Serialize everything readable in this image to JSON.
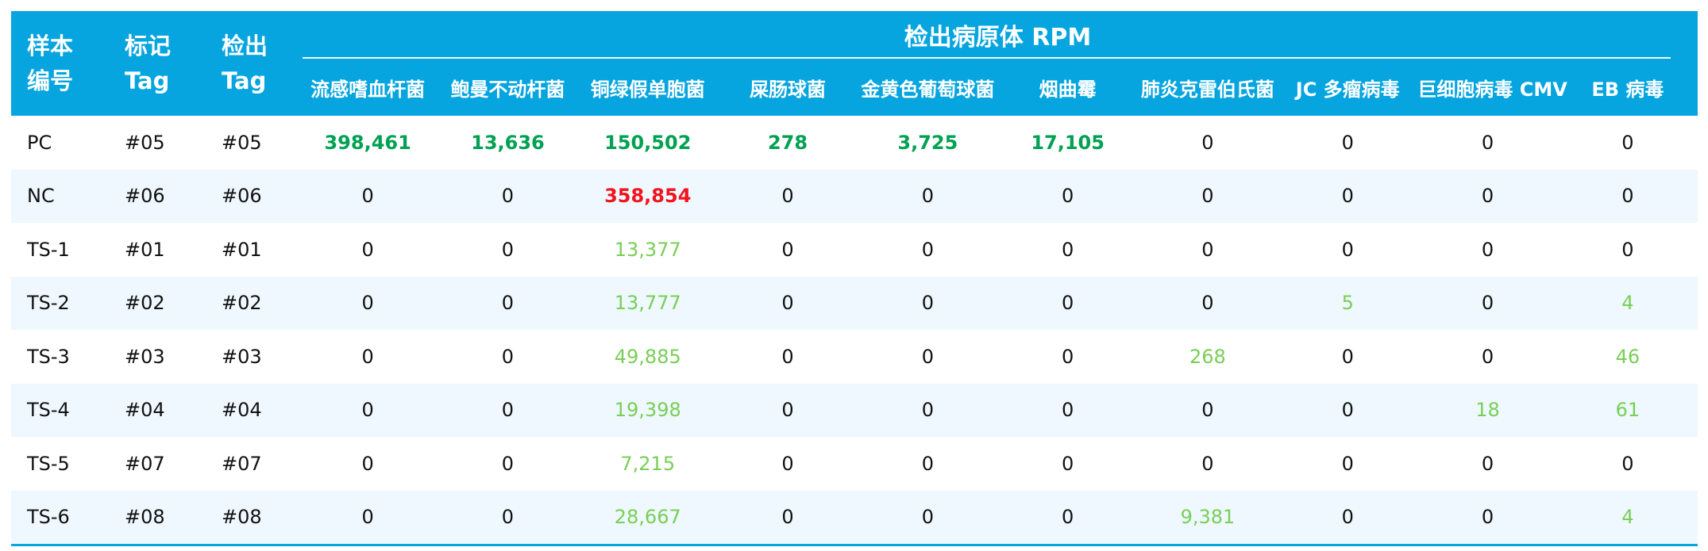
{
  "table": {
    "headers": {
      "sample_id_line1": "样本",
      "sample_id_line2": "编号",
      "tag_line1": "标记",
      "tag_line2": "Tag",
      "detected_line1": "检出",
      "detected_line2": "Tag",
      "group_title": "检出病原体 RPM"
    },
    "pathogens": [
      "流感嗜血杆菌",
      "鲍曼不动杆菌",
      "铜绿假单胞菌",
      "屎肠球菌",
      "金黄色葡萄球菌",
      "烟曲霉",
      "肺炎克雷伯氏菌",
      "JC 多瘤病毒",
      "巨细胞病毒 CMV",
      "EB 病毒"
    ],
    "rows": [
      {
        "sample": "PC",
        "tag": "#05",
        "detected_tag": "#05",
        "values": [
          "398,461",
          "13,636",
          "150,502",
          "278",
          "3,725",
          "17,105",
          "0",
          "0",
          "0",
          "0"
        ],
        "styles": [
          "pos-strong",
          "pos-strong",
          "pos-strong",
          "pos-strong",
          "pos-strong",
          "pos-strong",
          "plain",
          "plain",
          "plain",
          "plain"
        ]
      },
      {
        "sample": "NC",
        "tag": "#06",
        "detected_tag": "#06",
        "values": [
          "0",
          "0",
          "358,854",
          "0",
          "0",
          "0",
          "0",
          "0",
          "0",
          "0"
        ],
        "styles": [
          "plain",
          "plain",
          "neg-strong",
          "plain",
          "plain",
          "plain",
          "plain",
          "plain",
          "plain",
          "plain"
        ]
      },
      {
        "sample": "TS-1",
        "tag": "#01",
        "detected_tag": "#01",
        "values": [
          "0",
          "0",
          "13,377",
          "0",
          "0",
          "0",
          "0",
          "0",
          "0",
          "0"
        ],
        "styles": [
          "plain",
          "plain",
          "pos-light",
          "plain",
          "plain",
          "plain",
          "plain",
          "plain",
          "plain",
          "plain"
        ]
      },
      {
        "sample": "TS-2",
        "tag": "#02",
        "detected_tag": "#02",
        "values": [
          "0",
          "0",
          "13,777",
          "0",
          "0",
          "0",
          "0",
          "5",
          "0",
          "4"
        ],
        "styles": [
          "plain",
          "plain",
          "pos-light",
          "plain",
          "plain",
          "plain",
          "plain",
          "pos-light",
          "plain",
          "pos-light"
        ]
      },
      {
        "sample": "TS-3",
        "tag": "#03",
        "detected_tag": "#03",
        "values": [
          "0",
          "0",
          "49,885",
          "0",
          "0",
          "0",
          "268",
          "0",
          "0",
          "46"
        ],
        "styles": [
          "plain",
          "plain",
          "pos-light",
          "plain",
          "plain",
          "plain",
          "pos-light",
          "plain",
          "plain",
          "pos-light"
        ]
      },
      {
        "sample": "TS-4",
        "tag": "#04",
        "detected_tag": "#04",
        "values": [
          "0",
          "0",
          "19,398",
          "0",
          "0",
          "0",
          "0",
          "0",
          "18",
          "61"
        ],
        "styles": [
          "plain",
          "plain",
          "pos-light",
          "plain",
          "plain",
          "plain",
          "plain",
          "plain",
          "pos-light",
          "pos-light"
        ]
      },
      {
        "sample": "TS-5",
        "tag": "#07",
        "detected_tag": "#07",
        "values": [
          "0",
          "0",
          "7,215",
          "0",
          "0",
          "0",
          "0",
          "0",
          "0",
          "0"
        ],
        "styles": [
          "plain",
          "plain",
          "pos-light",
          "plain",
          "plain",
          "plain",
          "plain",
          "plain",
          "plain",
          "plain"
        ]
      },
      {
        "sample": "TS-6",
        "tag": "#08",
        "detected_tag": "#08",
        "values": [
          "0",
          "0",
          "28,667",
          "0",
          "0",
          "0",
          "9,381",
          "0",
          "0",
          "4"
        ],
        "styles": [
          "plain",
          "plain",
          "pos-light",
          "plain",
          "plain",
          "plain",
          "pos-light",
          "plain",
          "plain",
          "pos-light"
        ]
      }
    ]
  },
  "colors": {
    "header_blue": "#06a5df",
    "row_alt": "#eef8fe",
    "positive_strong": "#00a152",
    "negative_strong": "#f0141e",
    "positive_light": "#78cf56",
    "text_dark": "#111111"
  }
}
